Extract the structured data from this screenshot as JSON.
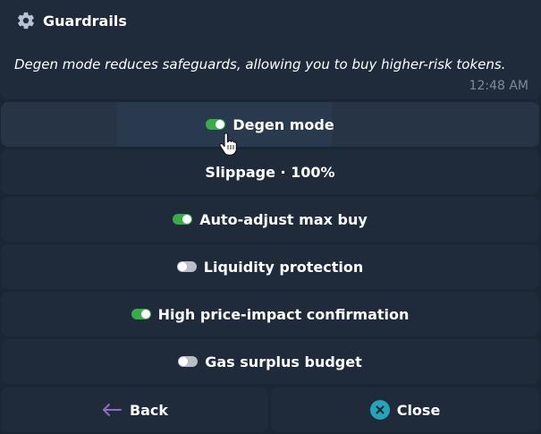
{
  "message": {
    "title": "Guardrails",
    "text": "Degen mode reduces safeguards, allowing you to buy higher-risk tokens.",
    "time": "12:48 AM",
    "title_icon": "gear-icon"
  },
  "keyboard": {
    "rows": [
      {
        "label": "Degen mode",
        "toggle": "on"
      },
      {
        "label": "Slippage · 100%",
        "toggle": "none"
      },
      {
        "label": "Auto-adjust max buy",
        "toggle": "on"
      },
      {
        "label": "Liquidity protection",
        "toggle": "off"
      },
      {
        "label": "High price-impact confirmation",
        "toggle": "on"
      },
      {
        "label": "Gas surplus budget",
        "toggle": "off"
      }
    ],
    "back_label": "Back",
    "close_label": "Close"
  },
  "colors": {
    "toggle_on": "#3aaa4a",
    "toggle_off": "#b9bec6",
    "back_arrow": "#8e6cc4",
    "close_icon": "#27a2b8"
  }
}
